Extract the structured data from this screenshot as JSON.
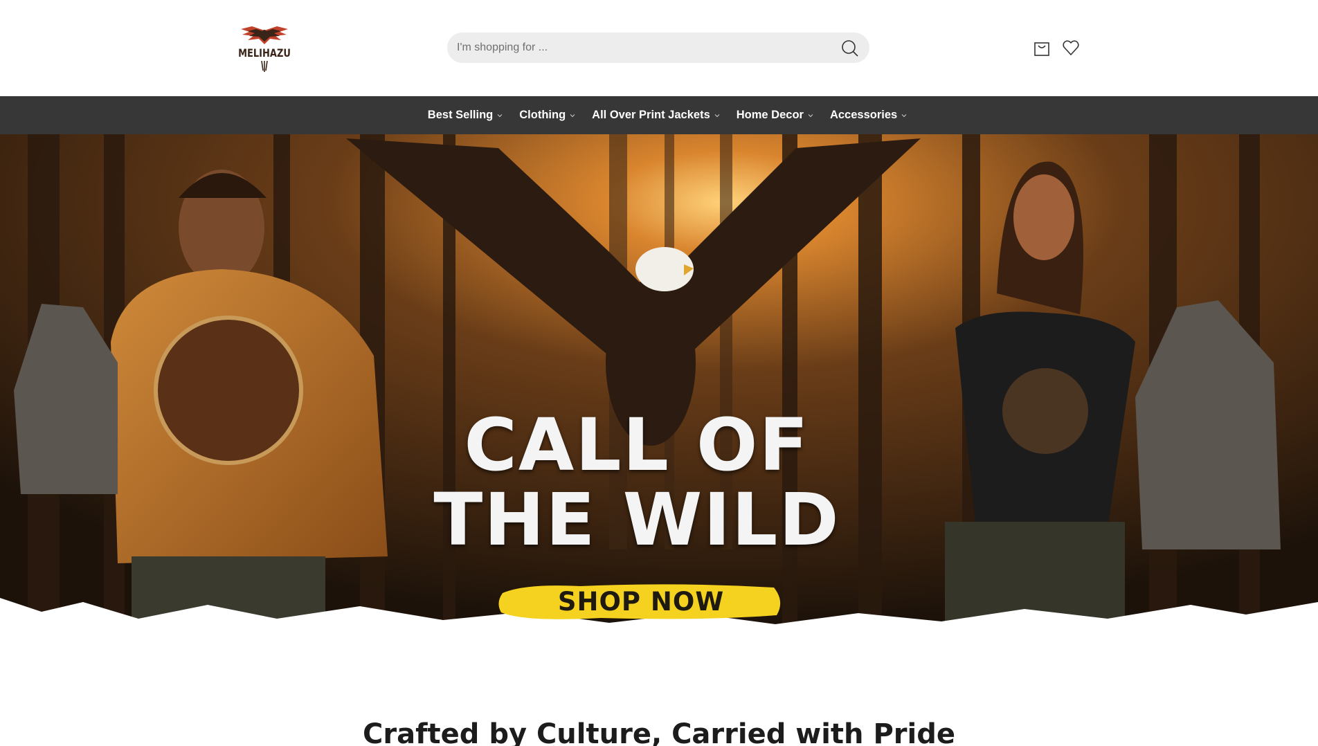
{
  "header": {
    "logo_text": "MELIHAZU",
    "search_placeholder": "I'm shopping for ...",
    "search_value": "",
    "icons": [
      "search-icon",
      "cart-icon",
      "heart-icon"
    ]
  },
  "nav": {
    "items": [
      {
        "label": "Best Selling"
      },
      {
        "label": "Clothing"
      },
      {
        "label": "All Over Print Jackets"
      },
      {
        "label": "Home Decor"
      },
      {
        "label": "Accessories"
      }
    ]
  },
  "hero": {
    "title_line1": "CALL OF",
    "title_line2": "THE WILD",
    "cta_label": "SHOP NOW",
    "colors": {
      "cta_brush": "#f4d21f",
      "forest_dark": "#2a1a0e",
      "sunlight": "#e89a3a"
    }
  },
  "section": {
    "tagline": "Crafted by Culture, Carried with Pride"
  }
}
